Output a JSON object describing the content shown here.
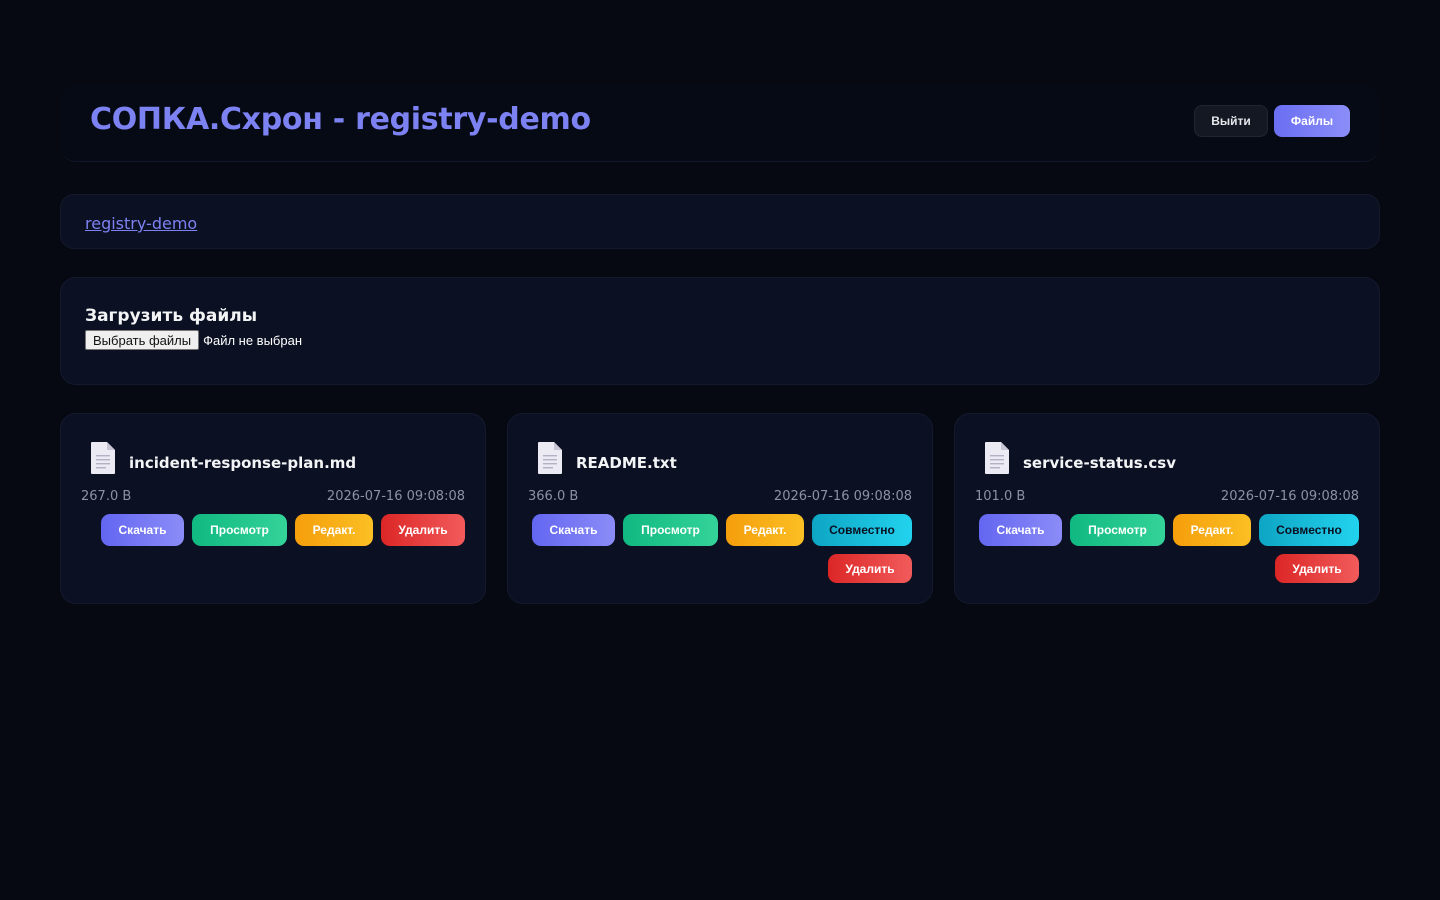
{
  "header": {
    "title": "СОПКА.Схрон - registry-demo",
    "logout_label": "Выйти",
    "files_label": "Файлы"
  },
  "breadcrumb": {
    "link": "registry-demo"
  },
  "upload": {
    "title": "Загрузить файлы",
    "choose_label": "Выбрать файлы",
    "no_file_text": "Файл не выбран"
  },
  "files": [
    {
      "name": "incident-response-plan.md",
      "size": "267.0 B",
      "date": "2026-07-16 09:08:08",
      "download": "Скачать",
      "view": "Просмотр",
      "edit": "Редакт.",
      "delete": "Удалить"
    },
    {
      "name": "README.txt",
      "size": "366.0 B",
      "date": "2026-07-16 09:08:08",
      "download": "Скачать",
      "view": "Просмотр",
      "edit": "Редакт.",
      "share": "Совместно",
      "delete": "Удалить"
    },
    {
      "name": "service-status.csv",
      "size": "101.0 B",
      "date": "2026-07-16 09:08:08",
      "download": "Скачать",
      "view": "Просмотр",
      "edit": "Редакт.",
      "share": "Совместно",
      "delete": "Удалить"
    }
  ],
  "colors": {
    "background": "#060911",
    "panel": "#0b1022",
    "accent": "#7d82f3",
    "download": "#6366f1",
    "view": "#10b981",
    "edit": "#f59e0b",
    "share": "#22d3ee",
    "delete": "#dc2626"
  },
  "icons": {
    "file": "document-icon"
  }
}
